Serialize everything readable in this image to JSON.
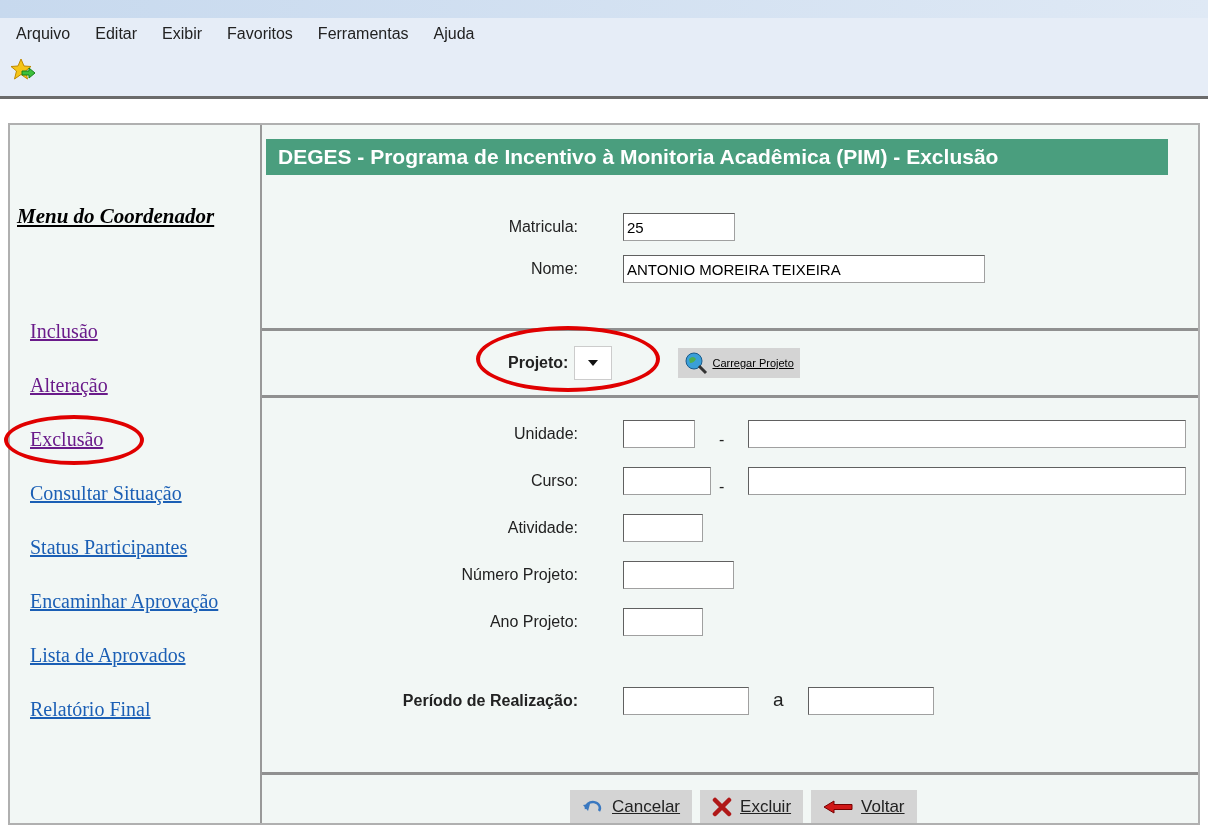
{
  "menu_bar": [
    "Arquivo",
    "Editar",
    "Exibir",
    "Favoritos",
    "Ferramentas",
    "Ajuda"
  ],
  "sidebar": {
    "title": "Menu do Coordenador",
    "items": [
      {
        "label": "Inclusão",
        "visited": true,
        "highlighted": false
      },
      {
        "label": "Alteração",
        "visited": true,
        "highlighted": false
      },
      {
        "label": "Exclusão",
        "visited": true,
        "highlighted": true
      },
      {
        "label": "Consultar Situação",
        "visited": false,
        "highlighted": false
      },
      {
        "label": "Status Participantes",
        "visited": false,
        "highlighted": false
      },
      {
        "label": "Encaminhar Aprovação",
        "visited": false,
        "highlighted": false
      },
      {
        "label": "Lista de Aprovados",
        "visited": false,
        "highlighted": false
      },
      {
        "label": "Relatório Final",
        "visited": false,
        "highlighted": false
      }
    ]
  },
  "header": "DEGES - Programa de Incentivo à Monitoria Acadêmica (PIM) - Exclusão",
  "identity": [
    {
      "label": "Matricula:",
      "value": "25"
    },
    {
      "label": "Nome:",
      "value": "ANTONIO MOREIRA TEIXEIRA"
    }
  ],
  "projeto": {
    "label": "Projeto:",
    "highlighted": true,
    "button": "Carregar Projeto"
  },
  "details": [
    {
      "label": "Unidade:",
      "kind": "pair",
      "separator": "-"
    },
    {
      "label": "Curso:",
      "kind": "pair",
      "separator": "-"
    },
    {
      "label": "Atividade:",
      "kind": "single"
    },
    {
      "label": "Número Projeto:",
      "kind": "single"
    },
    {
      "label": "Ano Projeto:",
      "kind": "single"
    }
  ],
  "period": {
    "label": "Período de Realização:",
    "separator": "a"
  },
  "buttons": [
    {
      "label": "Cancelar",
      "kind": "cancel"
    },
    {
      "label": "Excluir",
      "kind": "delete"
    },
    {
      "label": "Voltar",
      "kind": "back"
    }
  ]
}
